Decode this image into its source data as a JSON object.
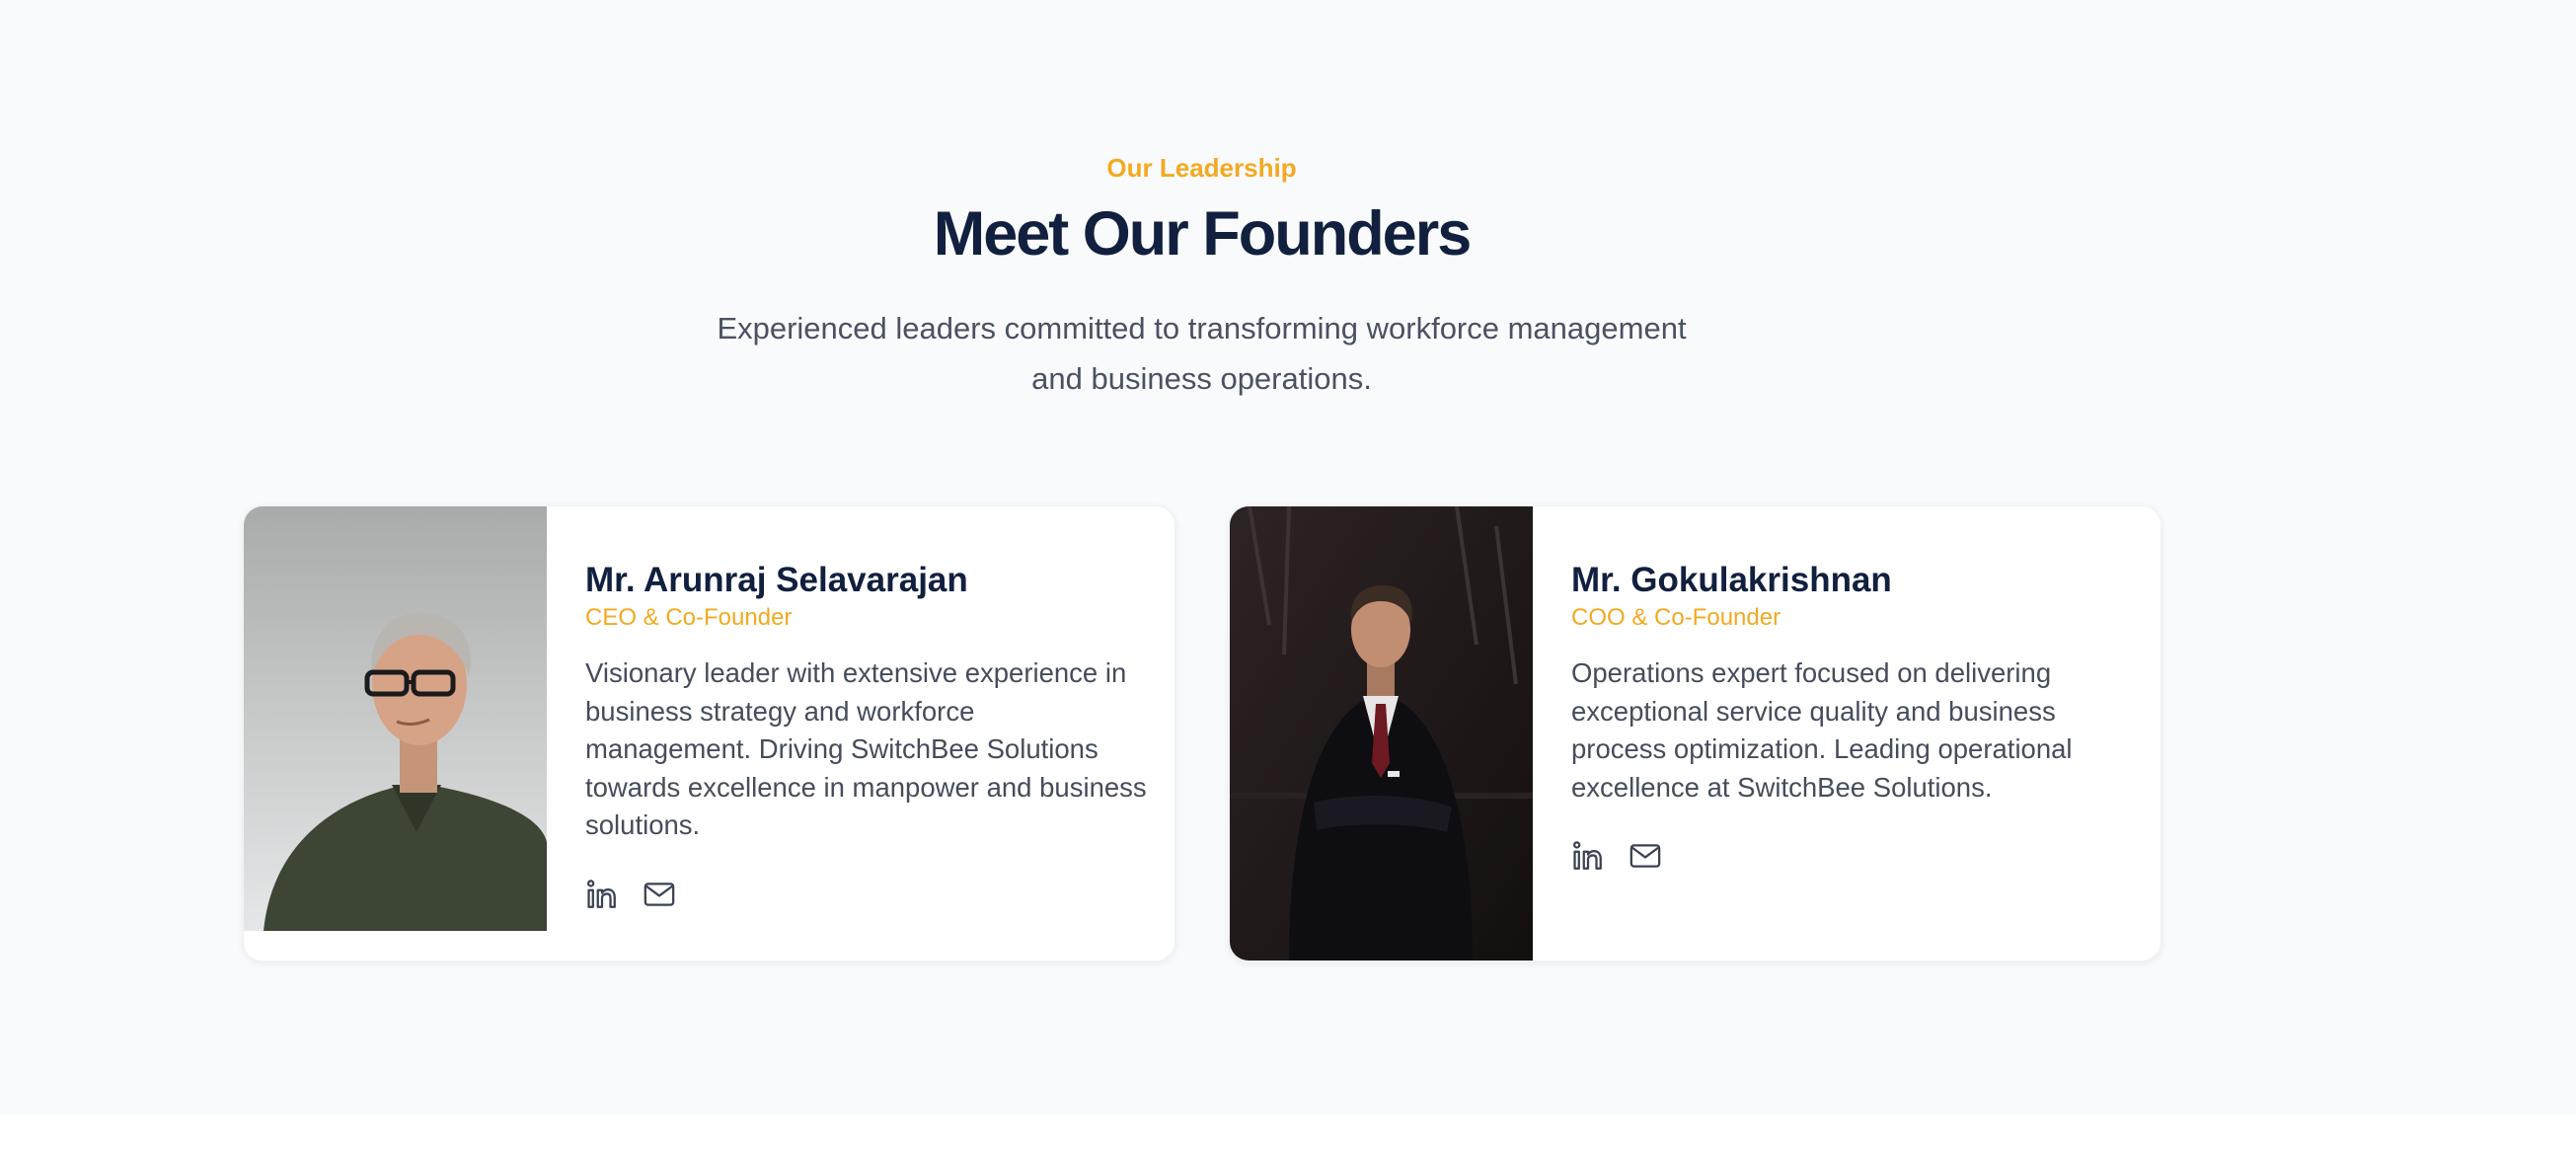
{
  "header": {
    "eyebrow": "Our Leadership",
    "title": "Meet Our Founders",
    "subtitle": "Experienced leaders committed to transforming workforce management and business operations."
  },
  "founders": [
    {
      "name": "Mr. Arunraj Selavarajan",
      "role": "CEO & Co-Founder",
      "bio": "Visionary leader with extensive experience in business strategy and workforce management. Driving SwitchBee Solutions towards excellence in manpower and business solutions.",
      "social_icons": [
        "linkedin-icon",
        "mail-icon"
      ]
    },
    {
      "name": "Mr. Gokulakrishnan",
      "role": "COO & Co-Founder",
      "bio": "Operations expert focused on delivering exceptional service quality and business process optimization. Leading operational excellence at SwitchBee Solutions.",
      "social_icons": [
        "linkedin-icon",
        "mail-icon"
      ]
    }
  ],
  "colors": {
    "accent": "#f2aa20",
    "heading": "#12203f",
    "body_text": "#454d5c",
    "section_bg": "#f9fafc"
  }
}
